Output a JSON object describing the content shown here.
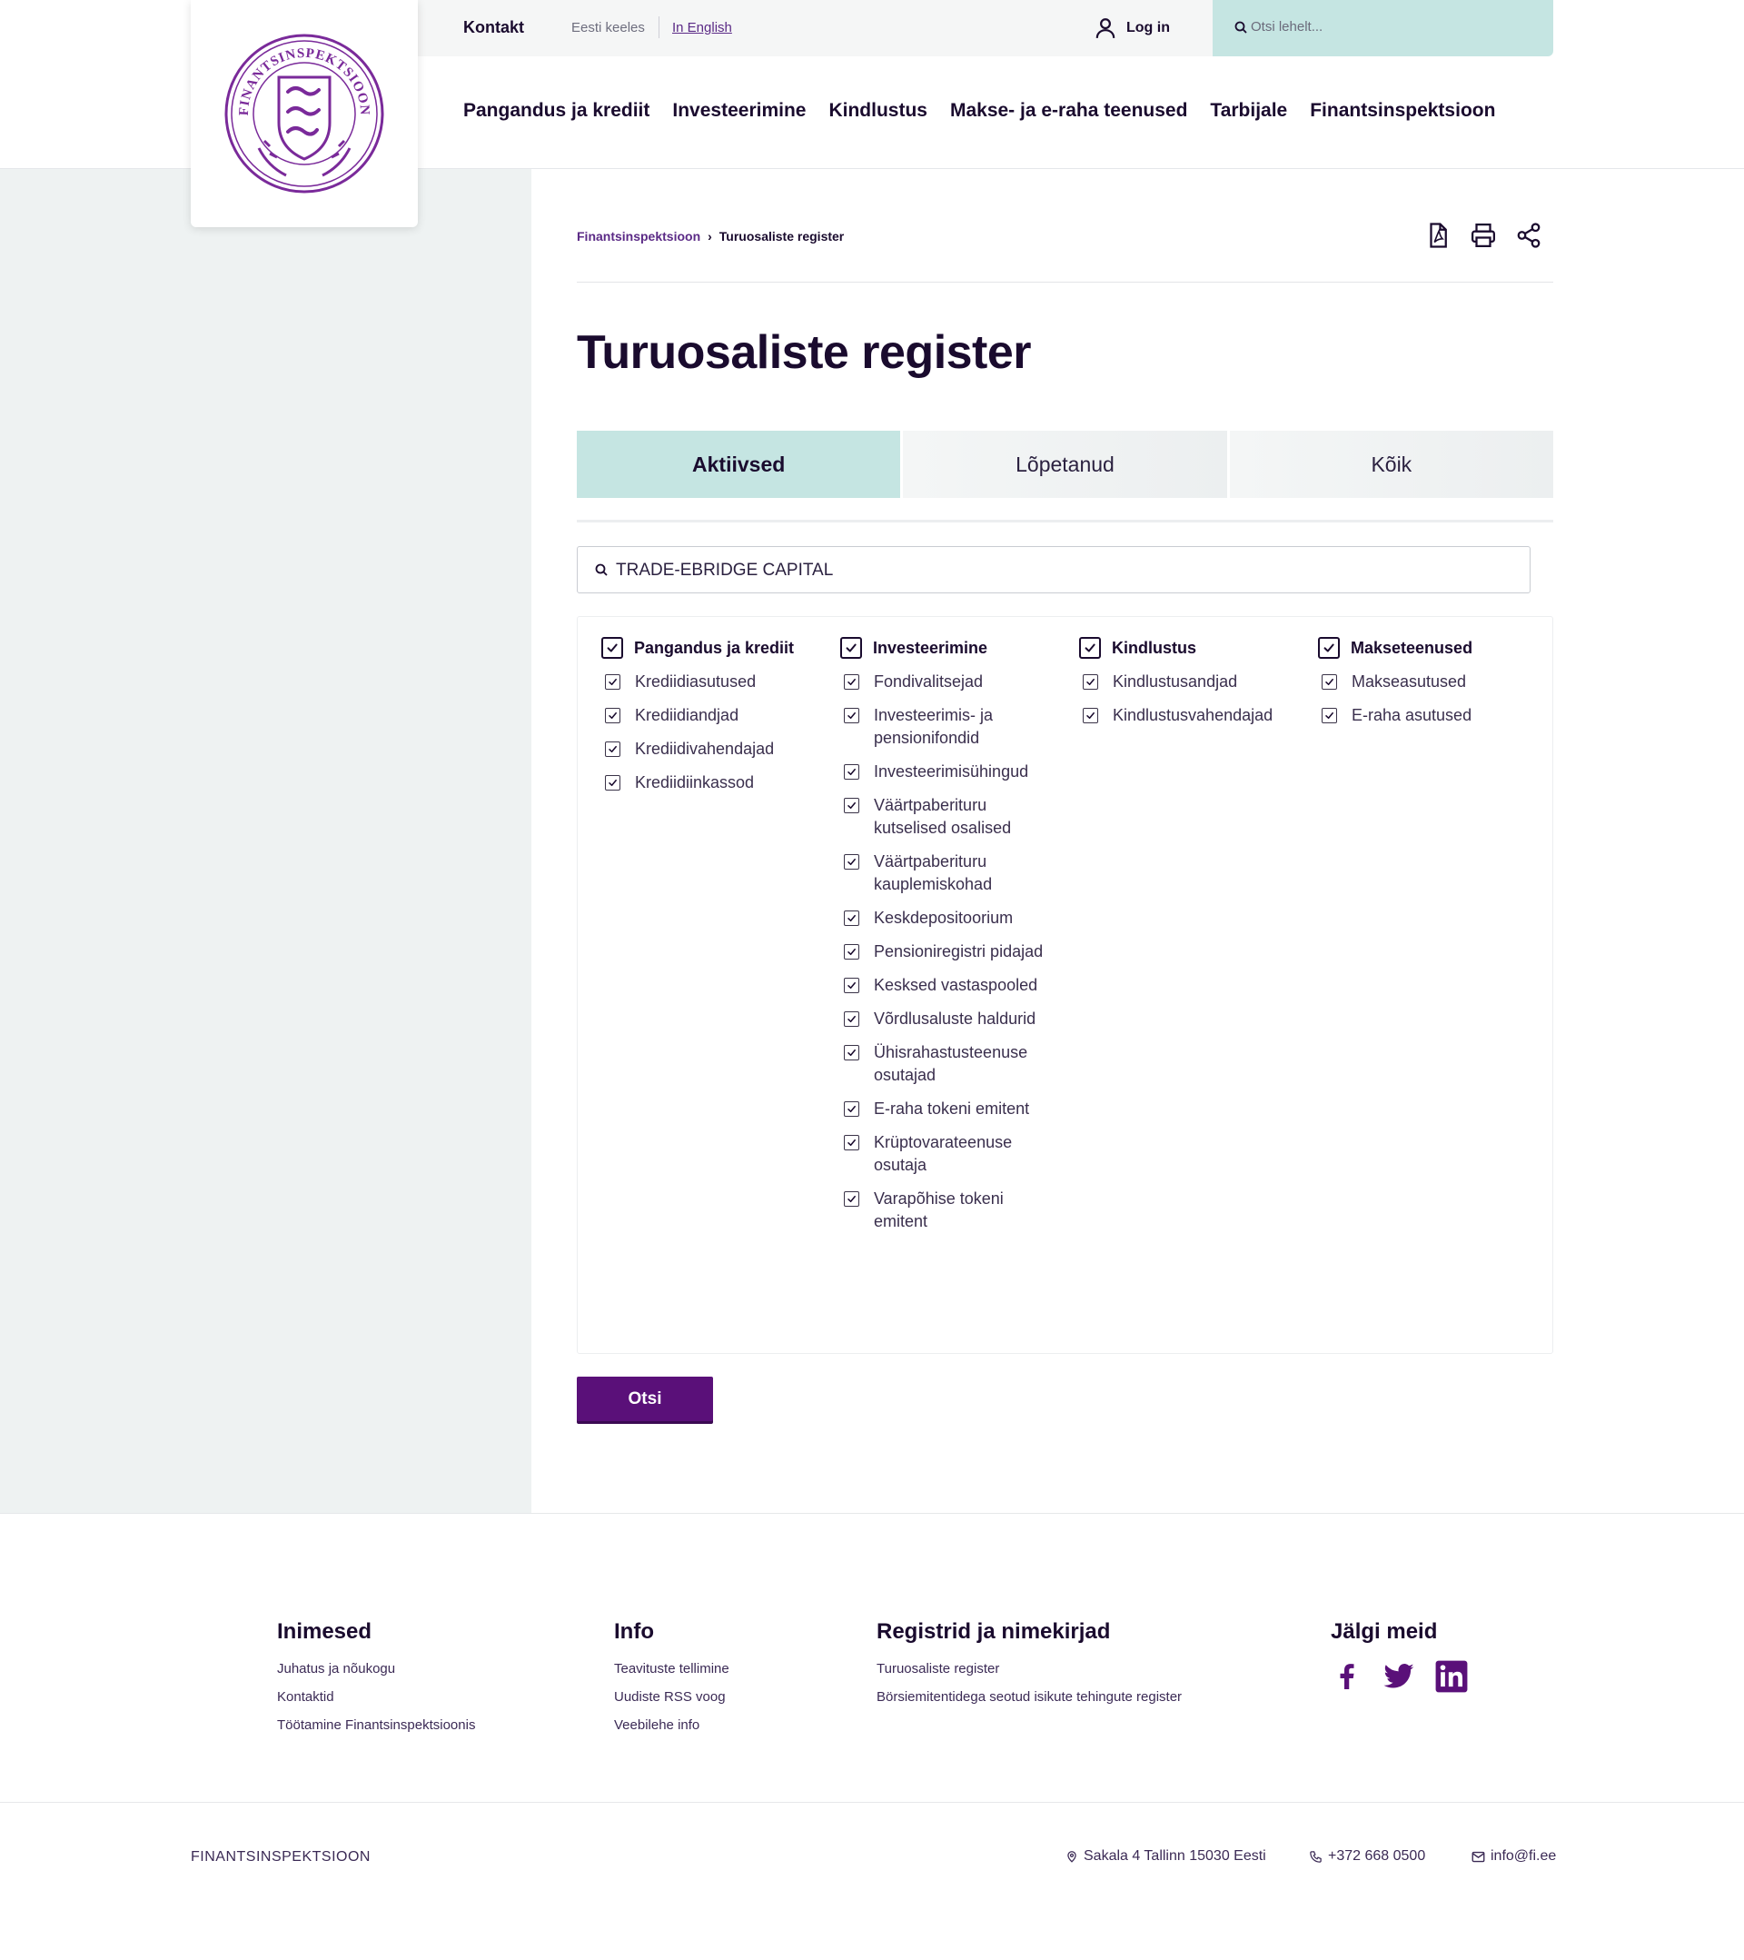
{
  "header": {
    "kontakt": "Kontakt",
    "lang_et": "Eesti keeles",
    "lang_en": "In English",
    "login": "Log in",
    "search_placeholder": "Otsi lehelt...",
    "logo_text": "FINANTSINSPEKTSIOON",
    "nav": [
      "Pangandus ja krediit",
      "Investeerimine",
      "Kindlustus",
      "Makse- ja e-raha teenused",
      "Tarbijale",
      "Finantsinspektsioon"
    ]
  },
  "breadcrumb": {
    "home": "Finantsinspektsioon",
    "current": "Turuosaliste register"
  },
  "tool_icons": [
    "pdf-icon",
    "print-icon",
    "share-icon"
  ],
  "page_title": "Turuosaliste register",
  "tabs": [
    {
      "label": "Aktiivsed",
      "active": true
    },
    {
      "label": "Lõpetanud",
      "active": false
    },
    {
      "label": "Kõik",
      "active": false
    }
  ],
  "search": {
    "value": "TRADE-EBRIDGE CAPITAL"
  },
  "filters": [
    {
      "group": "Pangandus ja krediit",
      "checked": true,
      "items": [
        "Krediidiasutused",
        "Krediidiandjad",
        "Krediidivahendajad",
        "Krediidiinkassod"
      ]
    },
    {
      "group": "Investeerimine",
      "checked": true,
      "items": [
        "Fondivalitsejad",
        "Investeerimis- ja pensionifondid",
        "Investeerimisühingud",
        "Väärtpaberituru kutselised osalised",
        "Väärtpaberituru kauplemiskohad",
        "Keskdepositoorium",
        "Pensioniregistri pidajad",
        "Kesksed vastaspooled",
        "Võrdlusaluste haldurid",
        "Ühisrahastusteenuse osutajad",
        "E-raha tokeni emitent",
        "Krüptovarateenuse osutaja",
        "Varapõhise tokeni emitent"
      ]
    },
    {
      "group": "Kindlustus",
      "checked": true,
      "items": [
        "Kindlustusandjad",
        "Kindlustusvahendajad"
      ]
    },
    {
      "group": "Makseteenused",
      "checked": true,
      "items": [
        "Makseasutused",
        "E-raha asutused"
      ]
    }
  ],
  "submit_label": "Otsi",
  "footer": {
    "columns": [
      {
        "title": "Inimesed",
        "links": [
          "Juhatus ja nõukogu",
          "Kontaktid",
          "Töötamine Finantsinspektsioonis"
        ]
      },
      {
        "title": "Info",
        "links": [
          "Teavituste tellimine",
          "Uudiste RSS voog",
          "Veebilehe info"
        ]
      },
      {
        "title": "Registrid ja nimekirjad",
        "links": [
          "Turuosaliste register",
          "Börsiemitentidega seotud isikute tehingute register"
        ]
      }
    ],
    "social_title": "Jälgi meid",
    "social_icons": [
      "facebook-icon",
      "twitter-icon",
      "linkedin-icon"
    ],
    "brand": "FINANTSINSPEKTSIOON",
    "address": "Sakala 4 Tallinn 15030 Eesti",
    "phone": "+372 668 0500",
    "email": "info@fi.ee",
    "accent_color": "#5a1079"
  }
}
